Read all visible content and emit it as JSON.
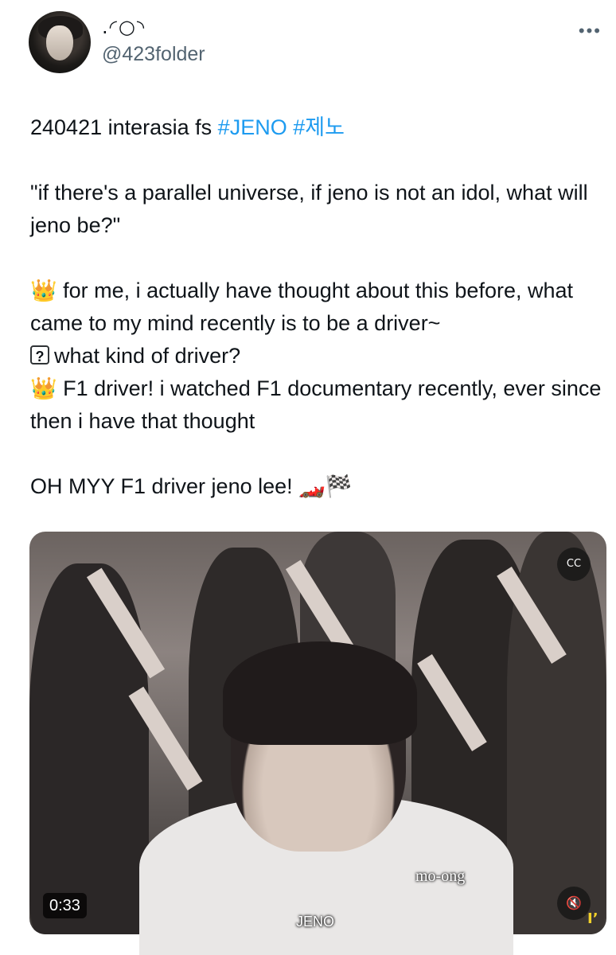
{
  "author": {
    "display_name": ".◜○◝",
    "handle": "@423folder"
  },
  "more_icon": "more-horizontal-icon",
  "tweet": {
    "line1_text": "240421 interasia fs ",
    "hashtags": [
      "#JENO",
      "#제노"
    ],
    "question": "\"if there's a parallel universe, if jeno is not an idol, what will jeno be?\"",
    "answer1_emoji": "👑",
    "answer1_text": " for me, i actually have thought about this before, what came to my mind recently is to be a driver~",
    "question2_mark": "?",
    "question2_text": "what kind of driver?",
    "answer2_emoji": "👑",
    "answer2_text": " F1 driver! i watched F1 documentary recently, ever since then i have that thought",
    "closing_text": "OH MYY F1 driver jeno lee! ",
    "closing_emojis": "🏎️🏁"
  },
  "video": {
    "duration": "0:33",
    "subtitle_left": "mo-ong",
    "subtitle_name": "JENO",
    "cc_icon": "captions-icon",
    "mute_icon": "mute-icon",
    "watermark": "I’"
  },
  "colors": {
    "link": "#1d9bf0",
    "text": "#0f1419",
    "secondary": "#536471"
  }
}
